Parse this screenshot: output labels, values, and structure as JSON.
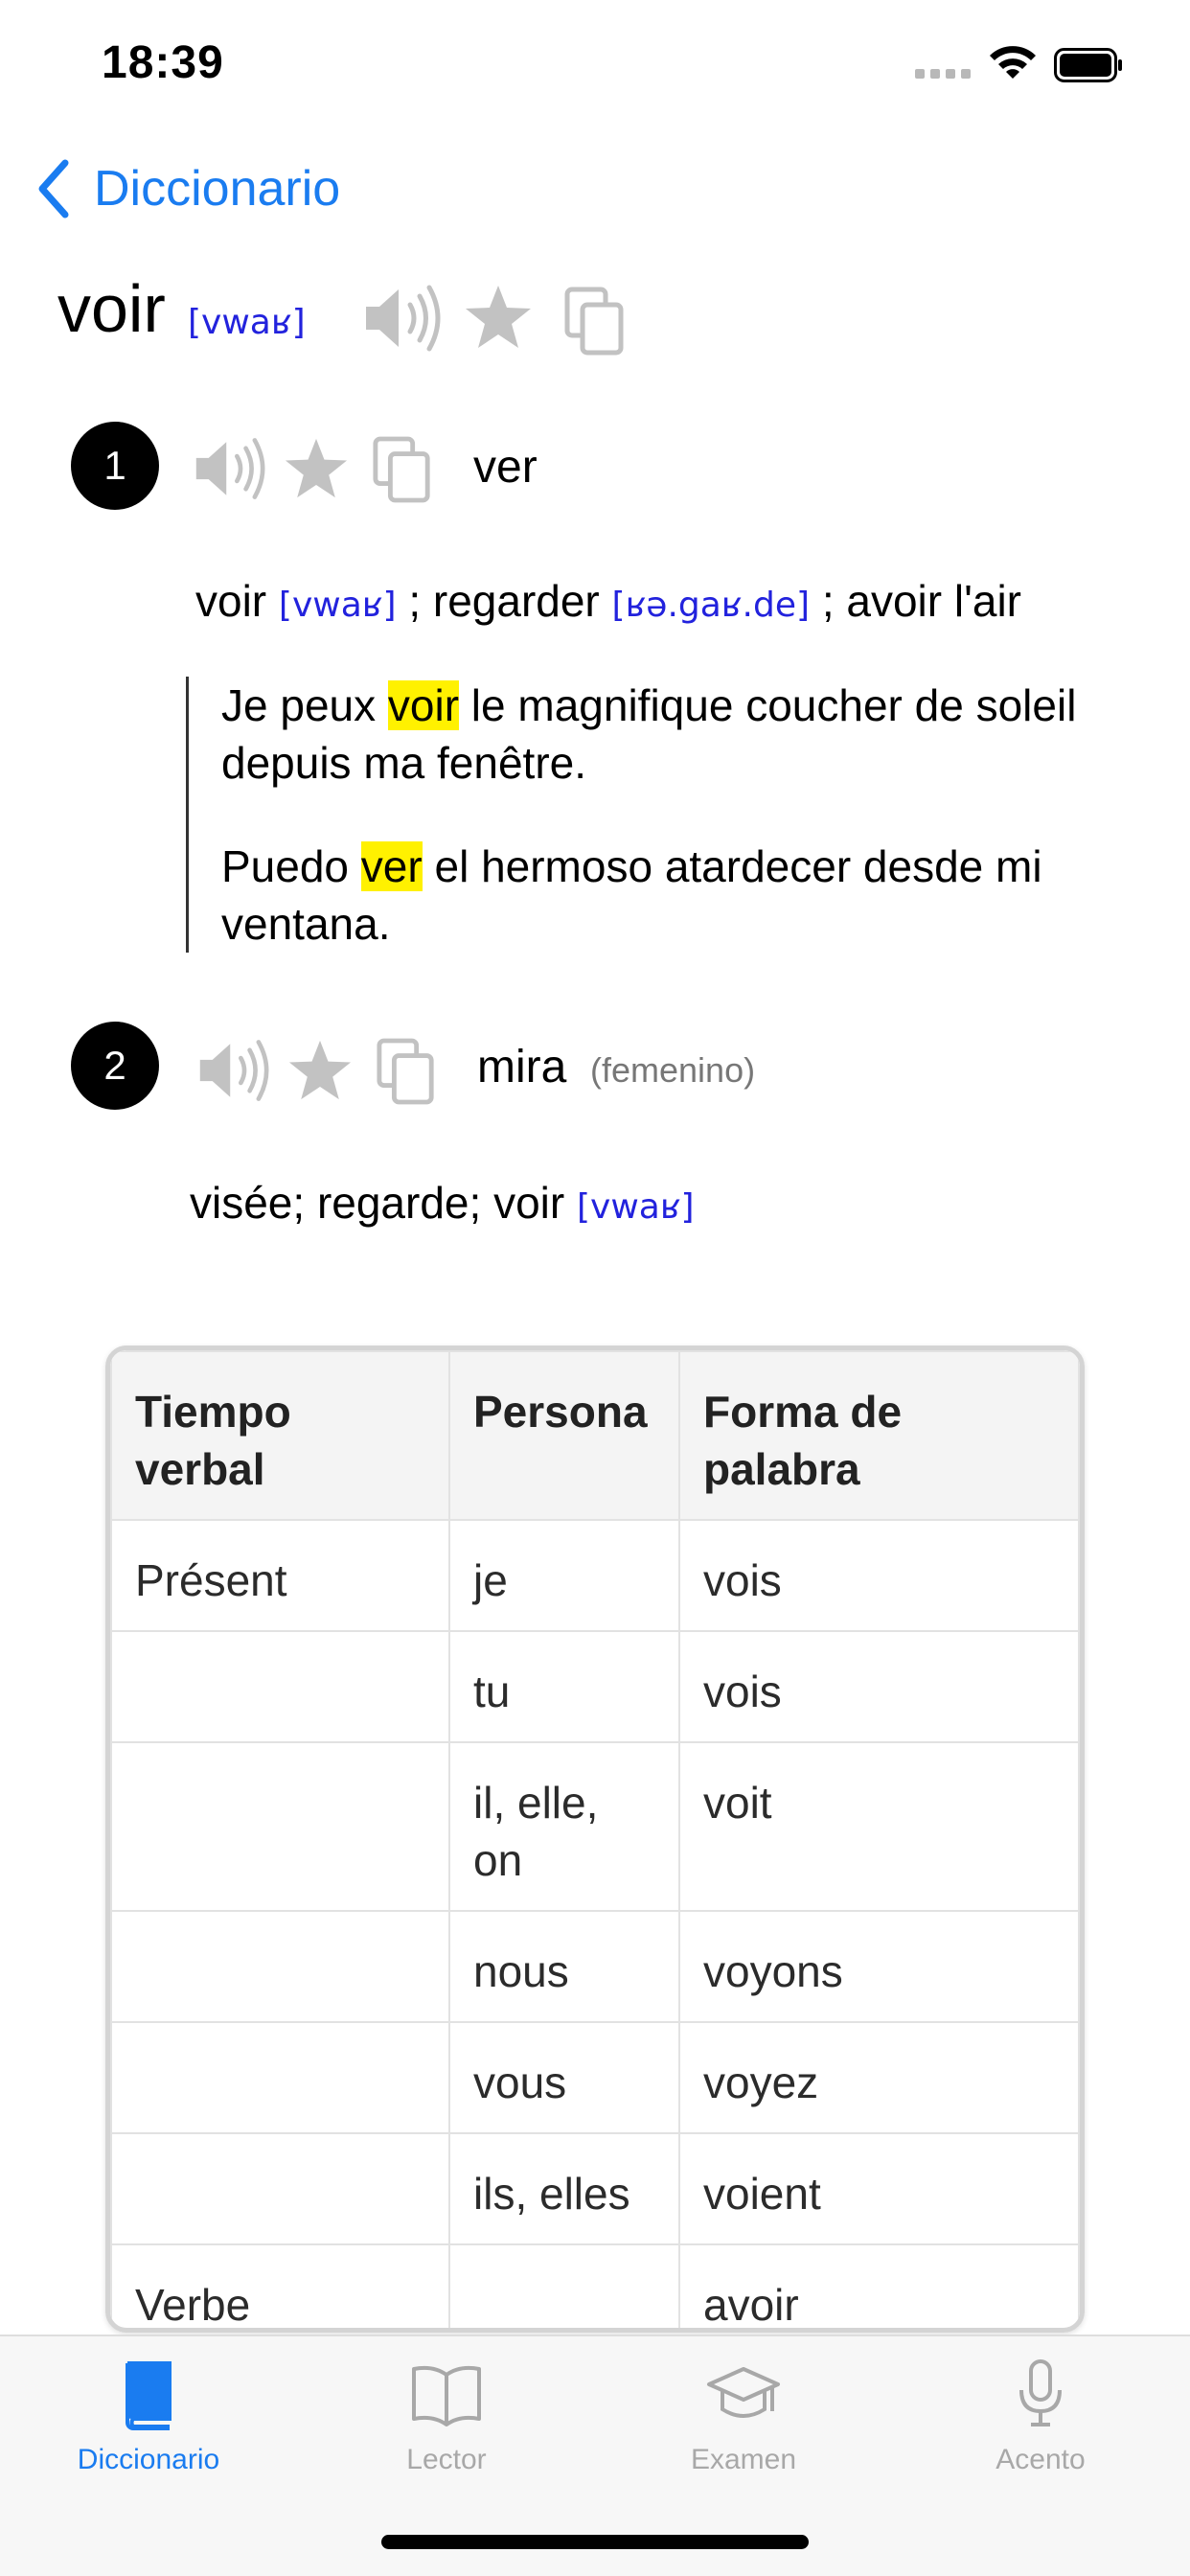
{
  "status_bar": {
    "time": "18:39"
  },
  "nav": {
    "back_label": "Diccionario"
  },
  "entry": {
    "headword": "voir",
    "pronunciation": "[vwaʁ]",
    "senses": [
      {
        "number": "1",
        "translation": "ver",
        "synonyms": [
          {
            "word": "voir",
            "pron": "[vwaʁ]",
            "sep": ";"
          },
          {
            "word": "regarder",
            "pron": "[ʁə.gaʁ.de]",
            "sep": ";"
          },
          {
            "word": "avoir l'air",
            "pron": "",
            "sep": ""
          }
        ],
        "example": {
          "source": {
            "before": "Je peux ",
            "highlight": "voir",
            "after": " le magnifique coucher de soleil depuis ma fenêtre."
          },
          "target": {
            "before": "Puedo ",
            "highlight": "ver",
            "after": " el hermoso atardecer desde mi ventana."
          }
        }
      },
      {
        "number": "2",
        "translation": "mira",
        "gender": "(femenino)",
        "synonyms_text": "visée; regarde;",
        "synonym_last": {
          "word": "voir",
          "pron": "[vwaʁ]"
        }
      }
    ]
  },
  "conjugation_table": {
    "headers": [
      "Tiempo verbal",
      "Persona",
      "Forma de palabra"
    ],
    "rows": [
      [
        "Présent",
        "je",
        "vois"
      ],
      [
        "",
        "tu",
        "vois"
      ],
      [
        "",
        "il, elle, on",
        "voit"
      ],
      [
        "",
        "nous",
        "voyons"
      ],
      [
        "",
        "vous",
        "voyez"
      ],
      [
        "",
        "ils, elles",
        "voient"
      ],
      [
        "Verbe auxiliaire",
        "",
        "avoir"
      ]
    ]
  },
  "tab_bar": {
    "tabs": [
      {
        "label": "Diccionario",
        "icon": "book-filled-icon",
        "active": true
      },
      {
        "label": "Lector",
        "icon": "open-book-icon",
        "active": false
      },
      {
        "label": "Examen",
        "icon": "graduation-cap-icon",
        "active": false
      },
      {
        "label": "Acento",
        "icon": "microphone-icon",
        "active": false
      }
    ]
  },
  "colors": {
    "accent": "#1a7cf0",
    "phonetic": "#2222dd",
    "highlight": "#fff100",
    "icon_gray": "#c2c2c2"
  }
}
